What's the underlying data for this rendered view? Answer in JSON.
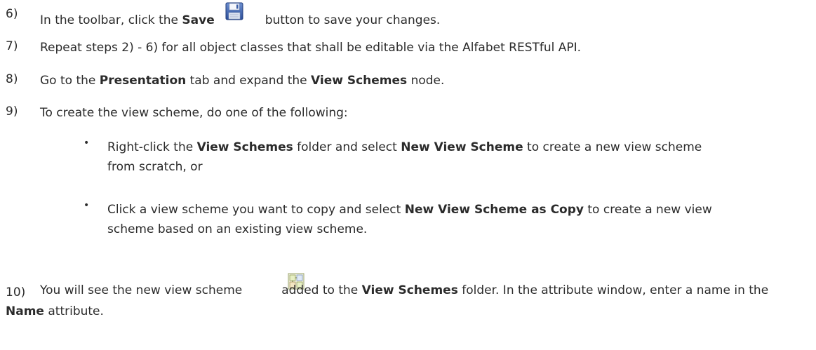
{
  "steps": [
    {
      "num": "6)",
      "p1": "In the toolbar, click the ",
      "b1": "Save",
      "p2": "button to save your changes."
    },
    {
      "num": "7)",
      "text": "Repeat steps 2) - 6) for all object classes that shall be editable via the Alfabet RESTful API."
    },
    {
      "num": "8)",
      "p1": "Go to the ",
      "b1": "Presentation",
      "p2": " tab and expand the ",
      "b2": "View Schemes",
      "p3": " node."
    },
    {
      "num": "9)",
      "text": "To create the view scheme, do one of the following:"
    },
    {
      "num": "10)",
      "p1": "You will see the new view scheme",
      "p2": "added to the ",
      "b1": "View Schemes",
      "p3": " folder. In the attribute window, enter a name in the ",
      "b2": "Name",
      "p4": " attribute."
    }
  ],
  "bullets": [
    {
      "symbol": "•",
      "p1": "Right-click the ",
      "b1": "View Schemes",
      "p2": " folder and select ",
      "b2": "New View Scheme",
      "p3": " to create a new view scheme from scratch, or"
    },
    {
      "symbol": "•",
      "p1": "Click a view scheme you want to copy and select ",
      "b1": "New View Scheme as Copy",
      "p2": " to create a new view scheme based on an existing view scheme."
    }
  ],
  "icons": {
    "save": "floppy-disk-save-icon",
    "view_scheme": "view-scheme-icon"
  }
}
